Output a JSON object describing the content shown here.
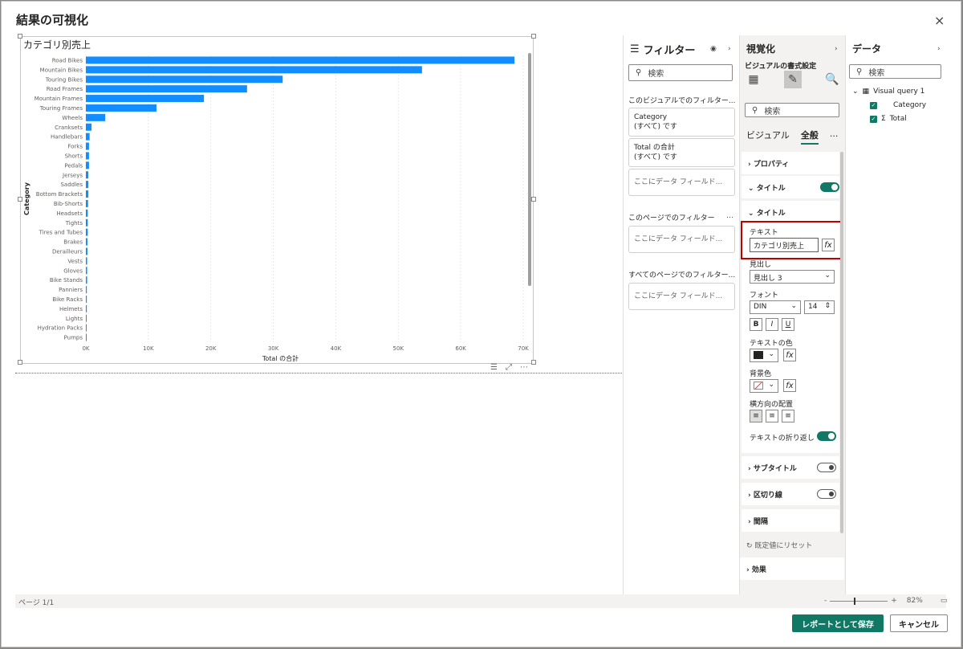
{
  "dialog": {
    "title": "結果の可視化",
    "close_icon": "×"
  },
  "visual": {
    "title": "カテゴリ別売上"
  },
  "chart_data": {
    "type": "bar",
    "orientation": "horizontal",
    "title": "カテゴリ別売上",
    "xlabel": "Total の合計",
    "ylabel": "Category",
    "xlim": [
      0,
      70000
    ],
    "x_ticks": [
      "0K",
      "10K",
      "20K",
      "30K",
      "40K",
      "50K",
      "60K",
      "70K"
    ],
    "categories": [
      "Road Bikes",
      "Mountain Bikes",
      "Touring Bikes",
      "Road Frames",
      "Mountain Frames",
      "Touring Frames",
      "Wheels",
      "Cranksets",
      "Handlebars",
      "Forks",
      "Shorts",
      "Pedals",
      "Jerseys",
      "Saddles",
      "Bottom Brackets",
      "Bib-Shorts",
      "Headsets",
      "Tights",
      "Tires and Tubes",
      "Brakes",
      "Derailleurs",
      "Vests",
      "Gloves",
      "Bike Stands",
      "Panniers",
      "Bike Racks",
      "Helmets",
      "Lights",
      "Hydration Packs",
      "Pumps"
    ],
    "values": [
      68600,
      53800,
      31500,
      25800,
      18900,
      11300,
      3100,
      900,
      600,
      500,
      500,
      500,
      400,
      400,
      400,
      350,
      300,
      300,
      300,
      250,
      250,
      200,
      200,
      200,
      150,
      150,
      150,
      100,
      100,
      100
    ],
    "bar_color": "#118dff",
    "grid": true
  },
  "status": {
    "page": "ページ 1/1",
    "zoom": "82%",
    "zoom_minus": "-",
    "zoom_plus": "+"
  },
  "filters": {
    "title": "フィルター",
    "search_placeholder": "検索",
    "visual_section": "このビジュアルでのフィルター...",
    "page_section": "このページでのフィルター",
    "all_section": "すべてのページでのフィルター...",
    "cards": [
      {
        "field": "Category",
        "state": "(すべて) です"
      },
      {
        "field": "Total の合計",
        "state": "(すべて) です"
      }
    ],
    "drop_label": "ここにデータ フィールド..."
  },
  "viz": {
    "title": "視覚化",
    "subtitle": "ビジュアルの書式設定",
    "search_placeholder": "検索",
    "tabs": [
      "ビジュアル",
      "全般"
    ],
    "more": "...",
    "properties": "プロパティ",
    "title_section": "タイトル",
    "title_sub": "タイトル",
    "text_label": "テキスト",
    "text_value": "カテゴリ別売上",
    "heading_label": "見出し",
    "heading_value": "見出し 3",
    "font_label": "フォント",
    "font_value": "DIN",
    "font_size": "14",
    "bold": "B",
    "italic": "I",
    "underline": "U",
    "text_color_label": "テキストの色",
    "bg_color_label": "背景色",
    "align_label": "横方向の配置",
    "wrap_label": "テキストの折り返し",
    "subtitle_section": "サブタイトル",
    "divider_section": "区切り線",
    "spacing_section": "間隔",
    "reset": "既定値にリセット",
    "effects": "効果",
    "fx": "fx",
    "colors": {
      "accent": "#117865",
      "text_color": "#252423",
      "highlight": "#c00000"
    }
  },
  "data_pane": {
    "title": "データ",
    "search_placeholder": "検索",
    "query": "Visual query 1",
    "fields": [
      "Category",
      "Total"
    ],
    "sigma": "Σ"
  },
  "buttons": {
    "save": "レポートとして保存",
    "cancel": "キャンセル"
  }
}
